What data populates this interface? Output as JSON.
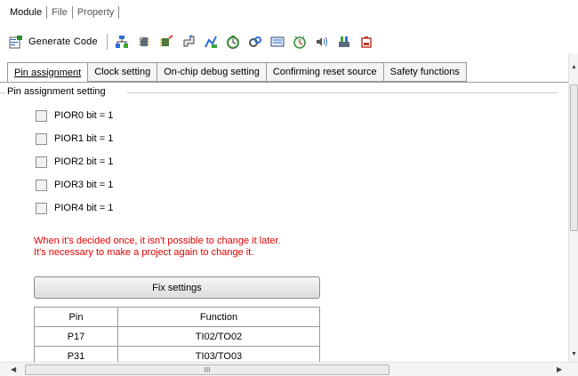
{
  "menu": {
    "items": [
      {
        "label": "Module"
      },
      {
        "label": "File"
      },
      {
        "label": "Property"
      }
    ]
  },
  "toolbar": {
    "generate_label": "Generate Code",
    "icons": [
      "pin-config-icon",
      "chip-icon",
      "clock-icon",
      "reset-icon",
      "port-icon",
      "timer-icon",
      "watchdog-icon",
      "display-icon",
      "rtc-icon",
      "sound-icon",
      "serial-icon",
      "battery-icon"
    ]
  },
  "tabs": [
    {
      "label": "Pin assignment",
      "active": true
    },
    {
      "label": "Clock setting",
      "active": false
    },
    {
      "label": "On-chip debug setting",
      "active": false
    },
    {
      "label": "Confirming reset source",
      "active": false
    },
    {
      "label": "Safety functions",
      "active": false
    }
  ],
  "group": {
    "title": "Pin assignment setting",
    "checkboxes": [
      {
        "label": "PIOR0 bit = 1",
        "checked": false
      },
      {
        "label": "PIOR1 bit = 1",
        "checked": false
      },
      {
        "label": "PIOR2 bit = 1",
        "checked": false
      },
      {
        "label": "PIOR3 bit = 1",
        "checked": false
      },
      {
        "label": "PIOR4 bit = 1",
        "checked": false
      }
    ]
  },
  "warning": {
    "line1": "When it's decided once, it isn't possible to change it later.",
    "line2": "It's necessary to make a project again to change it.",
    "color": "#e00000"
  },
  "fix_button": {
    "label": "Fix settings"
  },
  "pin_table": {
    "headers": [
      "Pin",
      "Function"
    ],
    "rows": [
      [
        "P17",
        "TI02/TO02"
      ],
      [
        "P31",
        "TI03/TO03"
      ]
    ]
  },
  "scrollbar": {
    "h_grip": "III"
  }
}
